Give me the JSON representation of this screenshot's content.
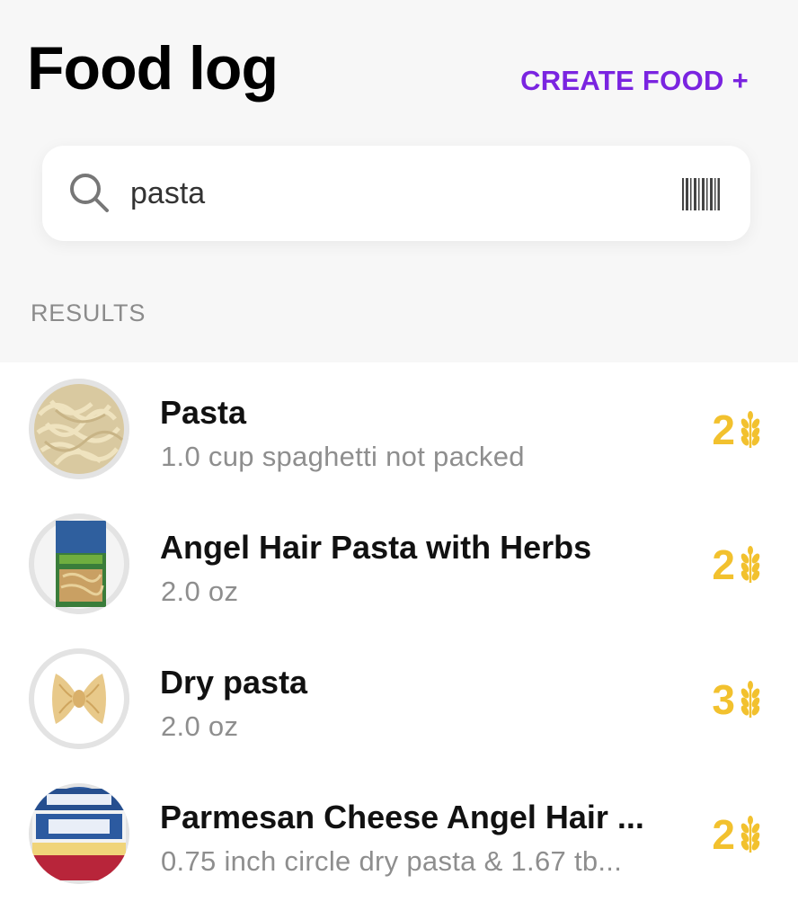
{
  "header": {
    "title": "Food log",
    "create_label": "CREATE FOOD +"
  },
  "search": {
    "value": "pasta",
    "icon": "search-icon",
    "barcode_icon": "barcode-icon"
  },
  "results_label": "RESULTS",
  "accent_color": "#7a24e0",
  "carb_color": "#f2c12e",
  "results": [
    {
      "name": "Pasta",
      "desc": "1.0 cup spaghetti not packed",
      "carbs": "2",
      "image": "spaghetti-photo"
    },
    {
      "name": "Angel Hair Pasta with Herbs",
      "desc": "2.0 oz",
      "carbs": "2",
      "image": "pasta-roni-box"
    },
    {
      "name": "Dry pasta",
      "desc": "2.0 oz",
      "carbs": "3",
      "image": "farfalle-photo"
    },
    {
      "name": "Parmesan Cheese Angel Hair ...",
      "desc": "0.75 inch circle dry pasta & 1.67 tb...",
      "carbs": "2",
      "image": "pasta-roni-parmesan-box"
    }
  ]
}
